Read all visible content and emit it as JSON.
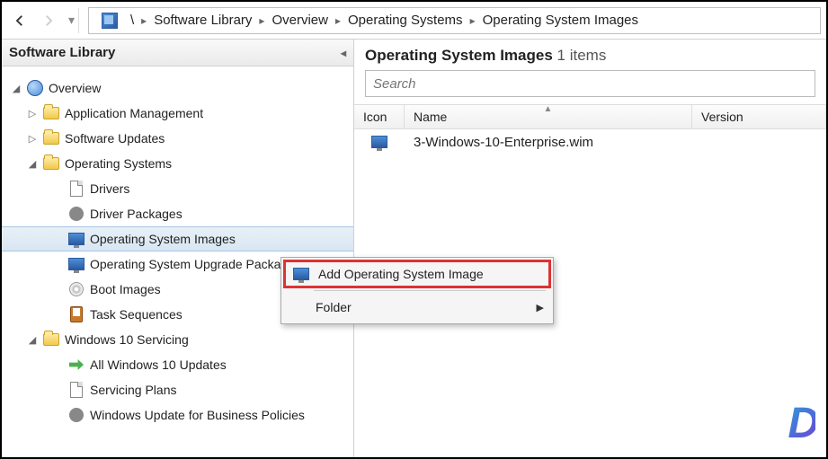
{
  "toolbar": {
    "breadcrumb": [
      "\\",
      "Software Library",
      "Overview",
      "Operating Systems",
      "Operating System Images"
    ]
  },
  "sidebar": {
    "title": "Software Library",
    "nodes": {
      "overview": "Overview",
      "app_mgmt": "Application Management",
      "sw_updates": "Software Updates",
      "os": "Operating Systems",
      "drivers": "Drivers",
      "driver_pkgs": "Driver Packages",
      "os_images": "Operating System Images",
      "os_upgrade": "Operating System Upgrade Packages",
      "boot_images": "Boot Images",
      "task_seq": "Task Sequences",
      "w10_serv": "Windows 10 Servicing",
      "all_w10": "All Windows 10 Updates",
      "serv_plans": "Servicing Plans",
      "wufb": "Windows Update for Business Policies"
    }
  },
  "content": {
    "title": "Operating System Images",
    "items_label": "1 items",
    "search_placeholder": "Search",
    "columns": {
      "icon": "Icon",
      "name": "Name",
      "version": "Version"
    },
    "rows": [
      {
        "name": "3-Windows-10-Enterprise.wim",
        "version": ""
      }
    ]
  },
  "context_menu": {
    "add": "Add Operating System Image",
    "folder": "Folder"
  },
  "watermark": "D"
}
